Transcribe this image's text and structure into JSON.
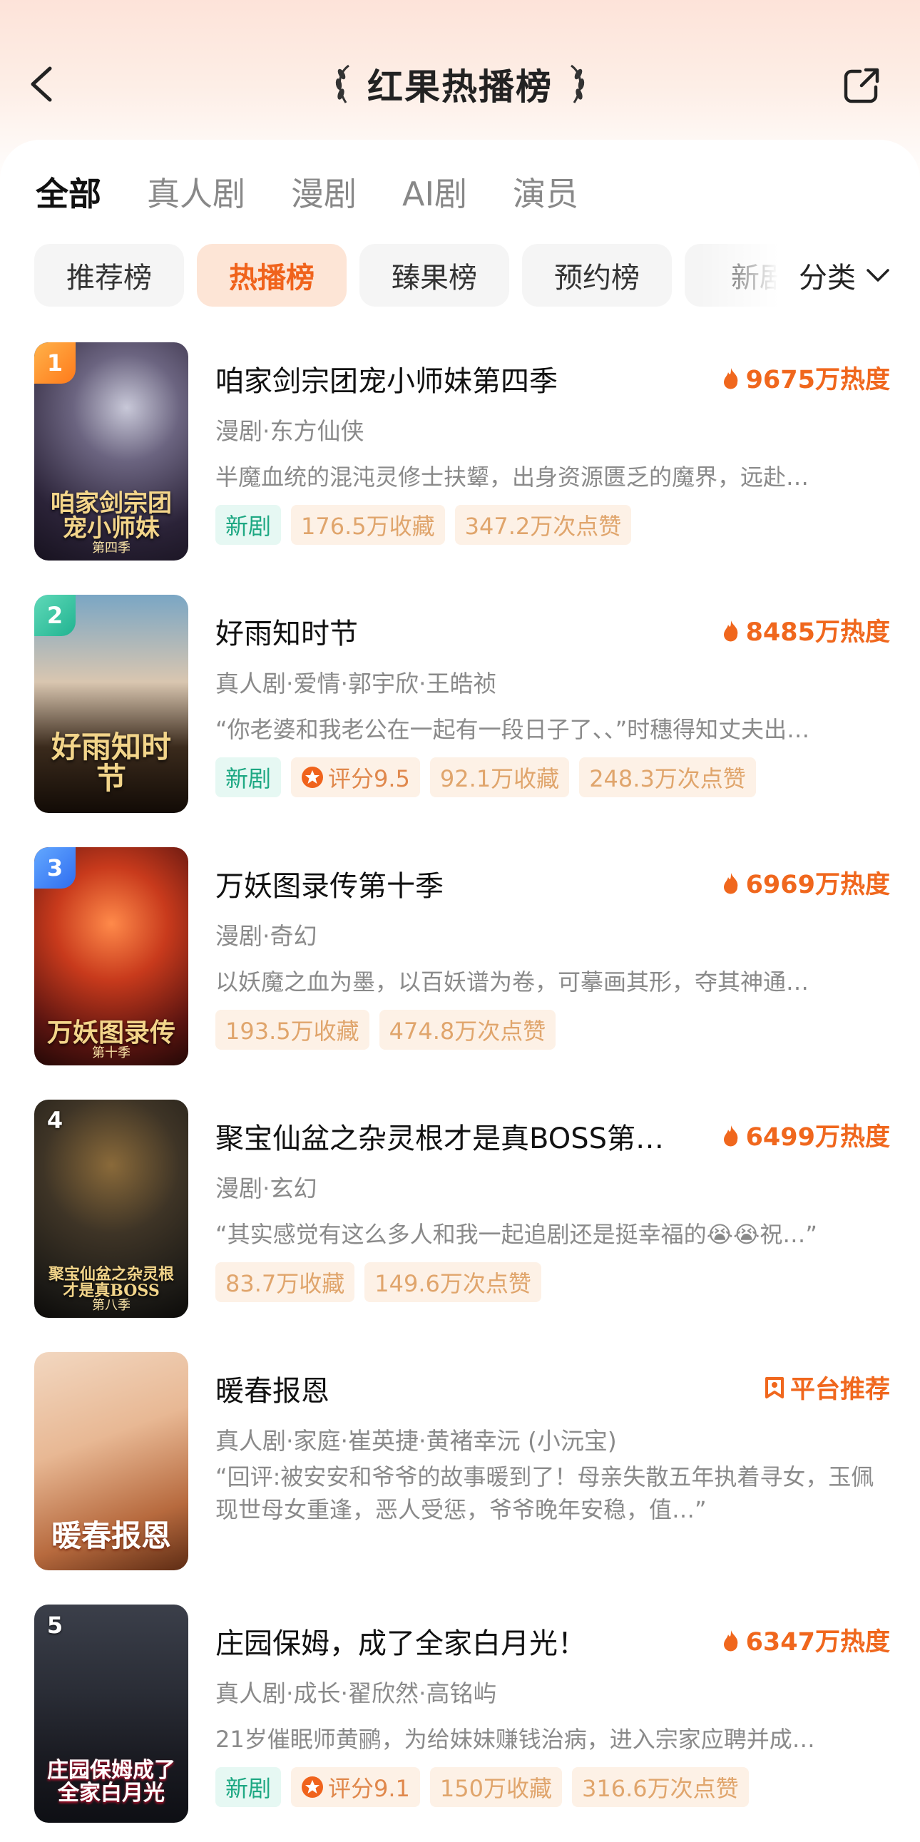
{
  "header": {
    "title": "红果热播榜"
  },
  "tabs": [
    {
      "label": "全部",
      "active": true
    },
    {
      "label": "真人剧",
      "active": false
    },
    {
      "label": "漫剧",
      "active": false
    },
    {
      "label": "AI剧",
      "active": false
    },
    {
      "label": "演员",
      "active": false
    }
  ],
  "subtabs": [
    {
      "label": "推荐榜",
      "active": false
    },
    {
      "label": "热播榜",
      "active": true
    },
    {
      "label": "臻果榜",
      "active": false
    },
    {
      "label": "预约榜",
      "active": false
    },
    {
      "label": "新剧",
      "active": false
    }
  ],
  "category_label": "分类",
  "colors": {
    "accent": "#f0631c",
    "heat": "#f0671d",
    "new_tag": "#1ea883",
    "rank1": "#ff8c2a",
    "rank2": "#2fc39f",
    "rank3": "#3b7ef5"
  },
  "items": [
    {
      "rank": "1",
      "name": "咱家剑宗团宠小师妹第四季",
      "badge": "9675万热度",
      "badge_icon": "flame-icon",
      "meta": "漫剧·东方仙侠",
      "desc": "半魔血统的混沌灵修士扶颦，出身资源匮乏的魔界，远赴…",
      "poster_title": "咱家剑宗团宠小师妹",
      "poster_sub": "第四季",
      "tags": [
        "新剧",
        "176.5万收藏",
        "347.2万次点赞"
      ]
    },
    {
      "rank": "2",
      "name": "好雨知时节",
      "badge": "8485万热度",
      "badge_icon": "flame-icon",
      "meta": "真人剧·爱情·郭宇欣·王皓祯",
      "desc": "“你老婆和我老公在一起有一段日子了、、”时穗得知丈夫出…",
      "poster_title": "好雨知时节",
      "poster_sub": "",
      "tags": [
        "新剧",
        "评分9.5",
        "92.1万收藏",
        "248.3万次点赞"
      ]
    },
    {
      "rank": "3",
      "name": "万妖图录传第十季",
      "badge": "6969万热度",
      "badge_icon": "flame-icon",
      "meta": "漫剧·奇幻",
      "desc": "以妖魔之血为墨，以百妖谱为卷，可摹画其形，夺其神通…",
      "poster_title": "万妖图录传",
      "poster_sub": "第十季",
      "tags": [
        "193.5万收藏",
        "474.8万次点赞"
      ]
    },
    {
      "rank": "4",
      "name": "聚宝仙盆之杂灵根才是真BOSS第…",
      "badge": "6499万热度",
      "badge_icon": "flame-icon",
      "meta": "漫剧·玄幻",
      "desc": "“其实感觉有这么多人和我一起追剧还是挺幸福的😭😭祝…”",
      "poster_title": "聚宝仙盆之杂灵根才是真BOSS",
      "poster_sub": "第八季",
      "tags": [
        "83.7万收藏",
        "149.6万次点赞"
      ]
    },
    {
      "rank": "",
      "name": "暖春报恩",
      "badge": "平台推荐",
      "badge_icon": "bookmark-icon",
      "meta": "真人剧·家庭·崔英捷·黄褚幸沅 (小沅宝)",
      "desc": "“回评:被安安和爷爷的故事暖到了！母亲失散五年执着寻女，玉佩现世母女重逢，恶人受惩，爷爷晚年安稳，值…”",
      "poster_title": "暖春报恩",
      "poster_sub": "",
      "tags": []
    },
    {
      "rank": "5",
      "name": "庄园保姆，成了全家白月光！",
      "badge": "6347万热度",
      "badge_icon": "flame-icon",
      "meta": "真人剧·成长·翟欣然·高铭屿",
      "desc": "21岁催眠师黄鹂，为给妹妹赚钱治病，进入宗家应聘并成…",
      "poster_title": "庄园保姆成了全家白月光",
      "poster_sub": "",
      "tags": [
        "新剧",
        "评分9.1",
        "150万收藏",
        "316.6万次点赞"
      ]
    }
  ]
}
